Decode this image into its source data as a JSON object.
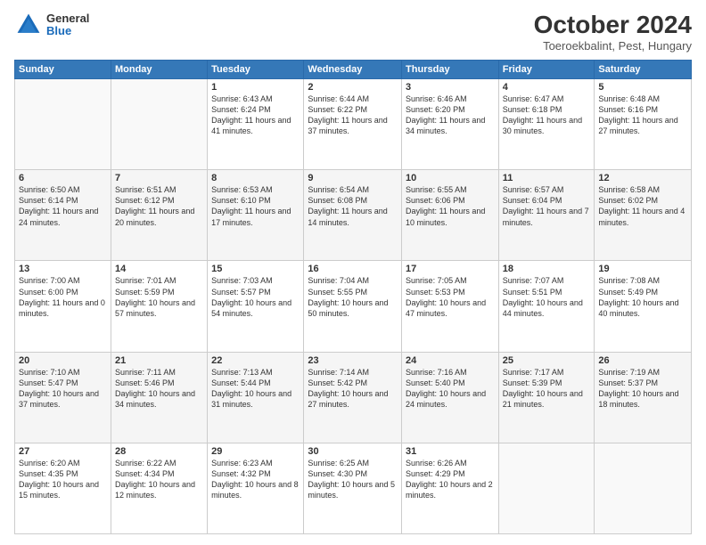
{
  "header": {
    "logo_general": "General",
    "logo_blue": "Blue",
    "title": "October 2024",
    "location": "Toeroekbalint, Pest, Hungary"
  },
  "days_of_week": [
    "Sunday",
    "Monday",
    "Tuesday",
    "Wednesday",
    "Thursday",
    "Friday",
    "Saturday"
  ],
  "weeks": [
    [
      {
        "day": "",
        "text": ""
      },
      {
        "day": "",
        "text": ""
      },
      {
        "day": "1",
        "text": "Sunrise: 6:43 AM\nSunset: 6:24 PM\nDaylight: 11 hours and 41 minutes."
      },
      {
        "day": "2",
        "text": "Sunrise: 6:44 AM\nSunset: 6:22 PM\nDaylight: 11 hours and 37 minutes."
      },
      {
        "day": "3",
        "text": "Sunrise: 6:46 AM\nSunset: 6:20 PM\nDaylight: 11 hours and 34 minutes."
      },
      {
        "day": "4",
        "text": "Sunrise: 6:47 AM\nSunset: 6:18 PM\nDaylight: 11 hours and 30 minutes."
      },
      {
        "day": "5",
        "text": "Sunrise: 6:48 AM\nSunset: 6:16 PM\nDaylight: 11 hours and 27 minutes."
      }
    ],
    [
      {
        "day": "6",
        "text": "Sunrise: 6:50 AM\nSunset: 6:14 PM\nDaylight: 11 hours and 24 minutes."
      },
      {
        "day": "7",
        "text": "Sunrise: 6:51 AM\nSunset: 6:12 PM\nDaylight: 11 hours and 20 minutes."
      },
      {
        "day": "8",
        "text": "Sunrise: 6:53 AM\nSunset: 6:10 PM\nDaylight: 11 hours and 17 minutes."
      },
      {
        "day": "9",
        "text": "Sunrise: 6:54 AM\nSunset: 6:08 PM\nDaylight: 11 hours and 14 minutes."
      },
      {
        "day": "10",
        "text": "Sunrise: 6:55 AM\nSunset: 6:06 PM\nDaylight: 11 hours and 10 minutes."
      },
      {
        "day": "11",
        "text": "Sunrise: 6:57 AM\nSunset: 6:04 PM\nDaylight: 11 hours and 7 minutes."
      },
      {
        "day": "12",
        "text": "Sunrise: 6:58 AM\nSunset: 6:02 PM\nDaylight: 11 hours and 4 minutes."
      }
    ],
    [
      {
        "day": "13",
        "text": "Sunrise: 7:00 AM\nSunset: 6:00 PM\nDaylight: 11 hours and 0 minutes."
      },
      {
        "day": "14",
        "text": "Sunrise: 7:01 AM\nSunset: 5:59 PM\nDaylight: 10 hours and 57 minutes."
      },
      {
        "day": "15",
        "text": "Sunrise: 7:03 AM\nSunset: 5:57 PM\nDaylight: 10 hours and 54 minutes."
      },
      {
        "day": "16",
        "text": "Sunrise: 7:04 AM\nSunset: 5:55 PM\nDaylight: 10 hours and 50 minutes."
      },
      {
        "day": "17",
        "text": "Sunrise: 7:05 AM\nSunset: 5:53 PM\nDaylight: 10 hours and 47 minutes."
      },
      {
        "day": "18",
        "text": "Sunrise: 7:07 AM\nSunset: 5:51 PM\nDaylight: 10 hours and 44 minutes."
      },
      {
        "day": "19",
        "text": "Sunrise: 7:08 AM\nSunset: 5:49 PM\nDaylight: 10 hours and 40 minutes."
      }
    ],
    [
      {
        "day": "20",
        "text": "Sunrise: 7:10 AM\nSunset: 5:47 PM\nDaylight: 10 hours and 37 minutes."
      },
      {
        "day": "21",
        "text": "Sunrise: 7:11 AM\nSunset: 5:46 PM\nDaylight: 10 hours and 34 minutes."
      },
      {
        "day": "22",
        "text": "Sunrise: 7:13 AM\nSunset: 5:44 PM\nDaylight: 10 hours and 31 minutes."
      },
      {
        "day": "23",
        "text": "Sunrise: 7:14 AM\nSunset: 5:42 PM\nDaylight: 10 hours and 27 minutes."
      },
      {
        "day": "24",
        "text": "Sunrise: 7:16 AM\nSunset: 5:40 PM\nDaylight: 10 hours and 24 minutes."
      },
      {
        "day": "25",
        "text": "Sunrise: 7:17 AM\nSunset: 5:39 PM\nDaylight: 10 hours and 21 minutes."
      },
      {
        "day": "26",
        "text": "Sunrise: 7:19 AM\nSunset: 5:37 PM\nDaylight: 10 hours and 18 minutes."
      }
    ],
    [
      {
        "day": "27",
        "text": "Sunrise: 6:20 AM\nSunset: 4:35 PM\nDaylight: 10 hours and 15 minutes."
      },
      {
        "day": "28",
        "text": "Sunrise: 6:22 AM\nSunset: 4:34 PM\nDaylight: 10 hours and 12 minutes."
      },
      {
        "day": "29",
        "text": "Sunrise: 6:23 AM\nSunset: 4:32 PM\nDaylight: 10 hours and 8 minutes."
      },
      {
        "day": "30",
        "text": "Sunrise: 6:25 AM\nSunset: 4:30 PM\nDaylight: 10 hours and 5 minutes."
      },
      {
        "day": "31",
        "text": "Sunrise: 6:26 AM\nSunset: 4:29 PM\nDaylight: 10 hours and 2 minutes."
      },
      {
        "day": "",
        "text": ""
      },
      {
        "day": "",
        "text": ""
      }
    ]
  ]
}
